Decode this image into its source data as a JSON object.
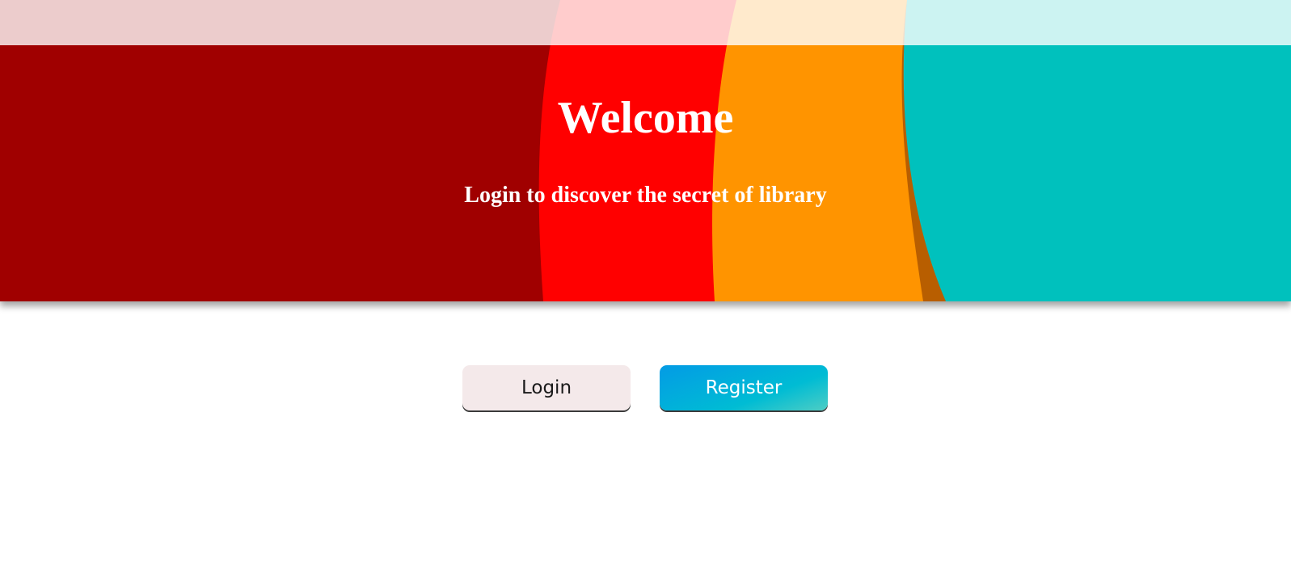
{
  "hero": {
    "title": "Welcome",
    "subtitle": "Login to discover the secret of library",
    "colors": [
      "#a00000",
      "#ff0000",
      "#ff9400",
      "#00c1bd"
    ]
  },
  "actions": {
    "login_label": "Login",
    "register_label": "Register"
  }
}
